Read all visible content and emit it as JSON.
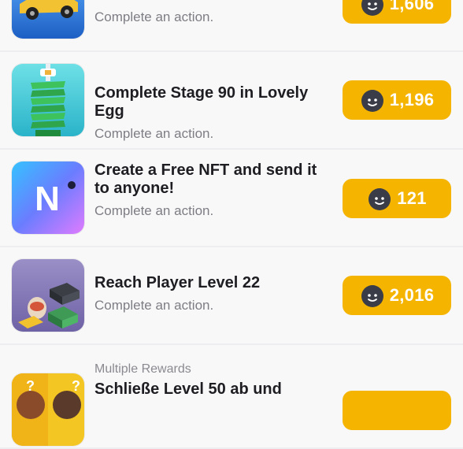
{
  "offers": [
    {
      "game": "Car Racing",
      "subtitle": "Complete an action.",
      "reward": "1,606"
    },
    {
      "game": "Lovely Egg",
      "title": "Complete Stage 90 in Lovely Egg",
      "subtitle": "Complete an action.",
      "reward": "1,196"
    },
    {
      "game": "NFT Creator",
      "title": "Create a Free NFT and send it to anyone!",
      "subtitle": "Complete an action.",
      "reward": "121",
      "logo_letter": "N"
    },
    {
      "game": "Block Stacker",
      "title": "Reach Player Level 22",
      "subtitle": "Complete an action.",
      "reward": "2,016"
    },
    {
      "category": "Multiple Rewards",
      "title": "Schließe Level 50 ab und"
    }
  ],
  "colors": {
    "accent": "#f4b400",
    "coin": "#3a3d48",
    "title": "#1d1d22",
    "subtitle": "#7d7d84"
  },
  "icons": {
    "currency": "smiley-coin-icon"
  }
}
